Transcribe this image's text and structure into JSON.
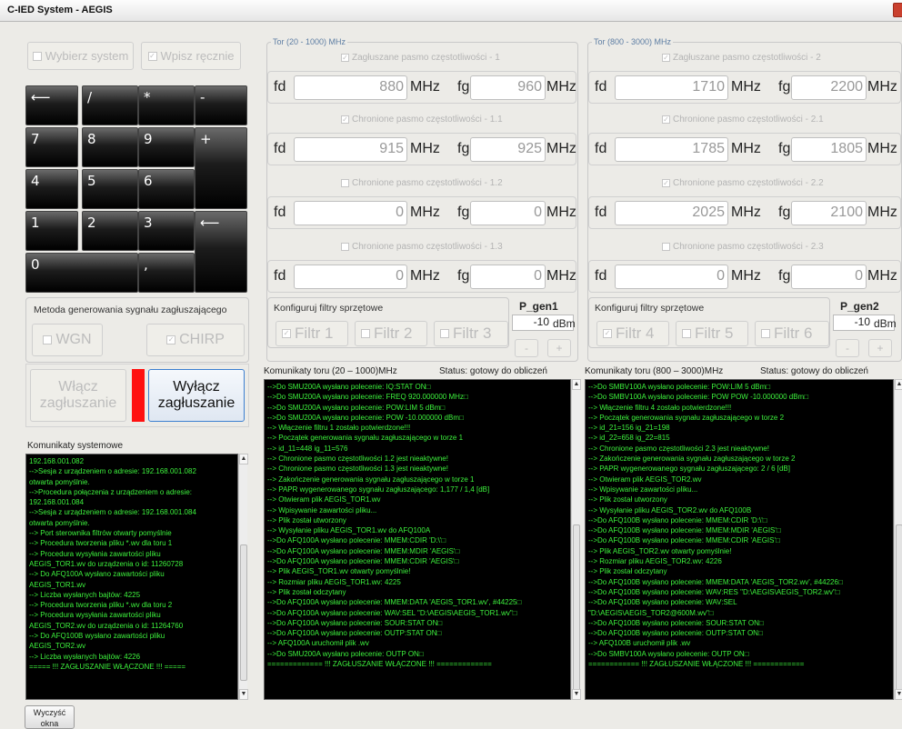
{
  "window": {
    "title": "C-IED System - AEGIS"
  },
  "top_buttons": {
    "choose_system": "Wybierz system",
    "manual_entry": "Wpisz ręcznie"
  },
  "keypad": {
    "keys": [
      "⟵",
      "/",
      "*",
      "-",
      "7",
      "8",
      "9",
      "+",
      "4",
      "5",
      "6",
      "1",
      "2",
      "3",
      "⟵",
      "0",
      ","
    ]
  },
  "method": {
    "label": "Metoda generowania sygnału zagłuszającego",
    "wgn": "WGN",
    "chirp": "CHIRP"
  },
  "jamming": {
    "on_label_1": "Włącz",
    "on_label_2": "zagłuszanie",
    "off_label_1": "Wyłącz",
    "off_label_2": "zagłuszanie",
    "indicator_color": "#ff1010"
  },
  "syslog": {
    "title": "Komunikaty systemowe",
    "lines": [
      "192.168.001.082",
      "-->Sesja z urządzeniem o adresie: 192.168.001.082",
      "otwarta pomyślnie.",
      "-->Procedura połączenia z urządzeniem o adresie:",
      "192.168.001.084",
      "-->Sesja z urządzeniem o adresie: 192.168.001.084",
      "otwarta pomyślnie.",
      "--> Port sterownika filtrów otwarty pomyślnie",
      "--> Procedura tworzenia pliku *.wv dla toru 1",
      "--> Procedura wysyłania zawartości pliku",
      "AEGIS_TOR1.wv do urządzenia o id: 11260728",
      "--> Do AFQ100A wysłano zawartości pliku",
      "AEGIS_TOR1.wv",
      "--> Liczba wysłanych bajtów: 4225",
      "--> Procedura tworzenia pliku *.wv dla toru 2",
      "--> Procedura wysyłania zawartości pliku",
      "AEGIS_TOR2.wv do urządzenia o id: 11264760",
      "--> Do AFQ100B wysłano zawartości pliku",
      "AEGIS_TOR2.wv",
      "--> Liczba wysłanych bajtów: 4226",
      "===== !!! ZAGŁUSZANIE  WŁĄCZONE !!! ====="
    ]
  },
  "clear_button": {
    "line1": "Wyczyść",
    "line2": "okna"
  },
  "tor1": {
    "group_title": "Tor (20 - 1000) MHz",
    "bands": [
      {
        "label": "Zagłuszane pasmo częstotliwości - 1",
        "fd": "880",
        "fg": "960"
      },
      {
        "label": "Chronione pasmo częstotliwości - 1.1",
        "fd": "915",
        "fg": "925"
      },
      {
        "label": "Chronione pasmo częstotliwości - 1.2",
        "fd": "0",
        "fg": "0"
      },
      {
        "label": "Chronione pasmo częstotliwości - 1.3",
        "fd": "0",
        "fg": "0"
      }
    ],
    "filters_title": "Konfiguruj filtry sprzętowe",
    "filters": [
      "Filtr 1",
      "Filtr 2",
      "Filtr 3"
    ],
    "pgen_label": "P_gen1",
    "pgen_value": "-10",
    "comm_title": "Komunikaty toru (20 – 1000)MHz",
    "status": "Status: gotowy do obliczeń",
    "log": [
      "-->Do SMU200A wysłano polecenie: IQ:STAT ON□",
      "-->Do SMU200A wysłano polecenie: FREQ 920.000000 MHz□",
      "-->Do SMU200A wysłano polecenie: POW:LIM 5 dBm□",
      "-->Do SMU200A wysłano polecenie: POW -10.000000 dBm□",
      "--> Włączenie filtru 1 zostało potwierdzone!!!",
      "--> Początek generowania sygnału zagłuszającego w torze 1",
      "--> id_11=448            ig_11=576",
      "--> Chronione pasmo częstotliwości 1.2 jest nieaktywne!",
      "--> Chronione pasmo częstotliwości 1.3 jest nieaktywne!",
      "--> Zakończenie generowania sygnału zagłuszającego w torze 1",
      "--> PAPR wygenerowanego sygnału zagłuszającego:  1,177 / 1,4 [dB]",
      "--> Otwieram plik AEGIS_TOR1.wv",
      "--> Wpisywanie zawartości pliku...",
      "--> Plik został utworzony",
      "--> Wysyłanie pliku AEGIS_TOR1.wv do AFQ100A",
      "-->Do AFQ100A wysłano polecenie: MMEM:CDIR 'D:\\'□",
      "-->Do AFQ100A wysłano polecenie: MMEM:MDIR 'AEGIS'□",
      "-->Do AFQ100A wysłano polecenie: MMEM:CDIR 'AEGIS'□",
      "--> Plik AEGIS_TOR1.wv otwarty pomyślnie!",
      "--> Rozmiar pliku AEGIS_TOR1.wv: 4225",
      "--> Plik został odczytany",
      "-->Do AFQ100A wysłano polecenie: MMEM:DATA 'AEGIS_TOR1.wv', #44225□",
      "-->Do AFQ100A wysłano polecenie: WAV:SEL \"D:\\AEGIS\\AEGIS_TOR1.wv\"□",
      "-->Do AFQ100A wysłano polecenie: SOUR:STAT ON□",
      "-->Do AFQ100A wysłano polecenie: OUTP:STAT ON□",
      "--> AFQ100A uruchomił plik .wv",
      "-->Do SMU200A wysłano polecenie: OUTP ON□",
      "============= !!! ZAGŁUSZANIE  WŁĄCZONE !!! ============="
    ]
  },
  "tor2": {
    "group_title": "Tor (800 - 3000) MHz",
    "bands": [
      {
        "label": "Zagłuszane pasmo częstotliwości - 2",
        "fd": "1710",
        "fg": "2200"
      },
      {
        "label": "Chronione pasmo częstotliwości - 2.1",
        "fd": "1785",
        "fg": "1805"
      },
      {
        "label": "Chronione pasmo częstotliwości - 2.2",
        "fd": "2025",
        "fg": "2100"
      },
      {
        "label": "Chronione pasmo częstotliwości - 2.3",
        "fd": "0",
        "fg": "0"
      }
    ],
    "filters_title": "Konfiguruj filtry sprzętowe",
    "filters": [
      "Filtr 4",
      "Filtr 5",
      "Filtr 6"
    ],
    "pgen_label": "P_gen2",
    "pgen_value": "-10",
    "comm_title": "Komunikaty toru (800 – 3000)MHz",
    "status": "Status: gotowy do obliczeń",
    "log": [
      "-->Do SMBV100A wysłano polecenie: POW:LIM 5 dBm□",
      "-->Do SMBV100A wysłano polecenie: POW POW -10.000000 dBm□",
      "--> Włączenie filtru 4 zostało potwierdzone!!!",
      "--> Początek generowania sygnału zagłuszającego w torze 2",
      "--> id_21=156        ig_21=198",
      "--> id_22=658        ig_22=815",
      "--> Chronione pasmo częstotliwości 2.3 jest nieaktywne!",
      "--> Zakończenie generowania sygnału zagłuszającego w torze 2",
      "--> PAPR wygenerowanego sygnału zagłuszającego:  2 / 6 [dB]",
      "--> Otwieram plik AEGIS_TOR2.wv",
      "--> Wpisywanie zawartości pliku...",
      "--> Plik został utworzony",
      "--> Wysyłanie pliku AEGIS_TOR2.wv do AFQ100B",
      "-->Do AFQ100B wysłano polecenie: MMEM:CDIR 'D:\\'□",
      "-->Do AFQ100B wysłano polecenie: MMEM:MDIR 'AEGIS'□",
      "-->Do AFQ100B wysłano polecenie: MMEM:CDIR 'AEGIS'□",
      "--> Plik AEGIS_TOR2.wv otwarty pomyślnie!",
      "--> Rozmiar pliku AEGIS_TOR2.wv: 4226",
      "--> Plik został odczytany",
      "-->Do AFQ100B wysłano polecenie: MMEM:DATA 'AEGIS_TOR2.wv', #44226□",
      "-->Do AFQ100B wysłano polecenie: WAV:RES \"D:\\AEGIS\\AEGIS_TOR2.wv\"□",
      "-->Do AFQ100B wysłano polecenie: WAV:SEL",
      "\"D:\\AEGIS\\AEGIS_TOR2@600M.wv\"□",
      "-->Do AFQ100B wysłano polecenie: SOUR:STAT ON□",
      "-->Do AFQ100B wysłano polecenie: OUTP:STAT ON□",
      "--> AFQ100B uruchomił plik .wv",
      "-->Do SMBV100A wysłano polecenie: OUTP ON□",
      "============ !!! ZAGŁUSZANIE  WŁĄCZONE !!! ============"
    ]
  },
  "labels": {
    "fd": "fd",
    "fg": "fg",
    "mhz": "MHz",
    "dbm": "dBm",
    "minus": "-",
    "plus": "+"
  }
}
